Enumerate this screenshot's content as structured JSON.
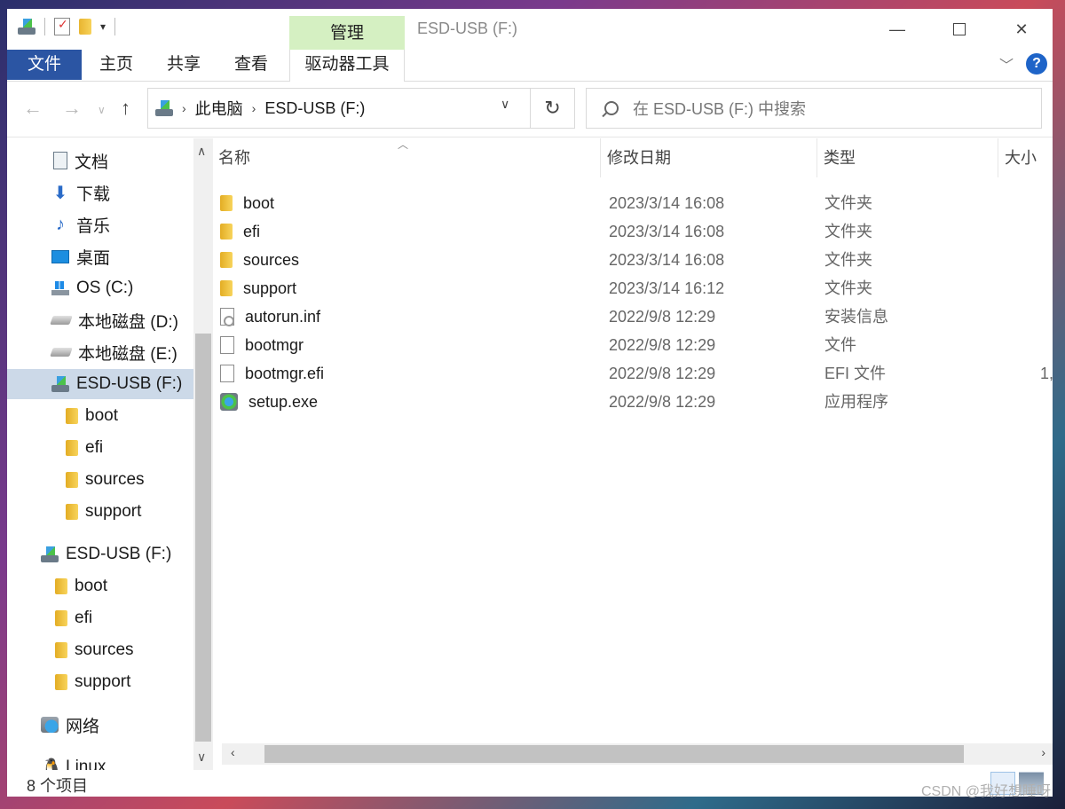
{
  "window": {
    "title": "ESD-USB (F:)",
    "context_tab_group": "管理",
    "controls": {
      "minimize": "—",
      "close": "✕"
    }
  },
  "ribbon": {
    "tabs": [
      "文件",
      "主页",
      "共享",
      "查看",
      "驱动器工具"
    ],
    "help": "?"
  },
  "address": {
    "crumbs": [
      "此电脑",
      "ESD-USB (F:)"
    ],
    "search_placeholder": "在 ESD-USB (F:) 中搜索"
  },
  "navpane": {
    "items": [
      {
        "label": "文档",
        "icon": "document-icon"
      },
      {
        "label": "下载",
        "icon": "download-icon"
      },
      {
        "label": "音乐",
        "icon": "music-icon"
      },
      {
        "label": "桌面",
        "icon": "desktop-icon"
      },
      {
        "label": "OS (C:)",
        "icon": "os-drive-icon"
      },
      {
        "label": "本地磁盘 (D:)",
        "icon": "hdd-icon"
      },
      {
        "label": "本地磁盘 (E:)",
        "icon": "hdd-icon"
      },
      {
        "label": "ESD-USB (F:)",
        "icon": "usb-drive-icon",
        "selected": true
      },
      {
        "label": "boot",
        "icon": "folder-icon"
      },
      {
        "label": "efi",
        "icon": "folder-icon"
      },
      {
        "label": "sources",
        "icon": "folder-icon"
      },
      {
        "label": "support",
        "icon": "folder-icon"
      },
      {
        "label": "ESD-USB (F:)",
        "icon": "usb-drive-icon"
      },
      {
        "label": "boot",
        "icon": "folder-icon"
      },
      {
        "label": "efi",
        "icon": "folder-icon"
      },
      {
        "label": "sources",
        "icon": "folder-icon"
      },
      {
        "label": "support",
        "icon": "folder-icon"
      },
      {
        "label": "网络",
        "icon": "network-icon"
      },
      {
        "label": "Linux",
        "icon": "linux-icon"
      }
    ]
  },
  "filelist": {
    "columns": [
      "名称",
      "修改日期",
      "类型",
      "大小"
    ],
    "rows": [
      {
        "name": "boot",
        "date": "2023/3/14 16:08",
        "type": "文件夹",
        "size": "",
        "icon": "folder-icon"
      },
      {
        "name": "efi",
        "date": "2023/3/14 16:08",
        "type": "文件夹",
        "size": "",
        "icon": "folder-icon"
      },
      {
        "name": "sources",
        "date": "2023/3/14 16:08",
        "type": "文件夹",
        "size": "",
        "icon": "folder-icon"
      },
      {
        "name": "support",
        "date": "2023/3/14 16:12",
        "type": "文件夹",
        "size": "",
        "icon": "folder-icon"
      },
      {
        "name": "autorun.inf",
        "date": "2022/9/8 12:29",
        "type": "安装信息",
        "size": "",
        "icon": "inf-file-icon"
      },
      {
        "name": "bootmgr",
        "date": "2022/9/8 12:29",
        "type": "文件",
        "size": "",
        "icon": "file-icon"
      },
      {
        "name": "bootmgr.efi",
        "date": "2022/9/8 12:29",
        "type": "EFI 文件",
        "size": "1,",
        "icon": "file-icon"
      },
      {
        "name": "setup.exe",
        "date": "2022/9/8 12:29",
        "type": "应用程序",
        "size": "",
        "icon": "exe-icon"
      }
    ]
  },
  "status": {
    "count": "8 个项目"
  },
  "watermark": "CSDN @我好想睡呀"
}
